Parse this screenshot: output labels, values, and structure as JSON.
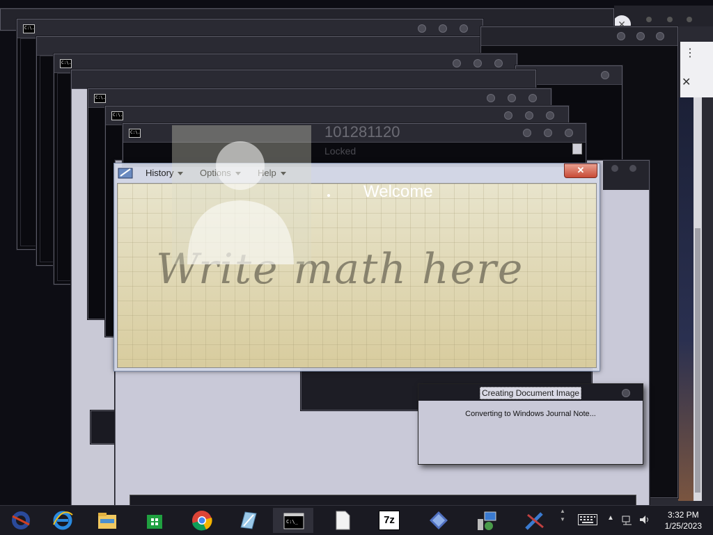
{
  "math_panel": {
    "menus": [
      {
        "label": "History"
      },
      {
        "label": "Options"
      },
      {
        "label": "Help"
      }
    ],
    "close_label": "✕",
    "hint": "Write math here"
  },
  "lock_overlay": {
    "user_id": "101281120",
    "status": "Locked",
    "welcome": "Welcome"
  },
  "dialog": {
    "title": "Creating Document Image",
    "message": "Converting to Windows Journal Note..."
  },
  "cmd": {
    "icon_text": "C:\\."
  },
  "right_panel": {
    "menu_glyph": "⋮",
    "close_glyph": "✕"
  },
  "taskbar": {
    "items": [
      {
        "name": "ie-dark-icon"
      },
      {
        "name": "internet-explorer-icon"
      },
      {
        "name": "file-explorer-icon"
      },
      {
        "name": "store-icon"
      },
      {
        "name": "chrome-icon"
      },
      {
        "name": "journal-icon"
      },
      {
        "name": "cmd-icon"
      },
      {
        "name": "document-icon"
      },
      {
        "name": "7zip-icon"
      },
      {
        "name": "diamond-app-icon"
      },
      {
        "name": "network-setup-icon"
      },
      {
        "name": "tools-icon"
      }
    ],
    "zip_label": "7z",
    "time": "3:32 PM",
    "date": "1/25/2023"
  },
  "colors": {
    "accent": "#c84a36",
    "canvas": "#e2dcbc"
  }
}
